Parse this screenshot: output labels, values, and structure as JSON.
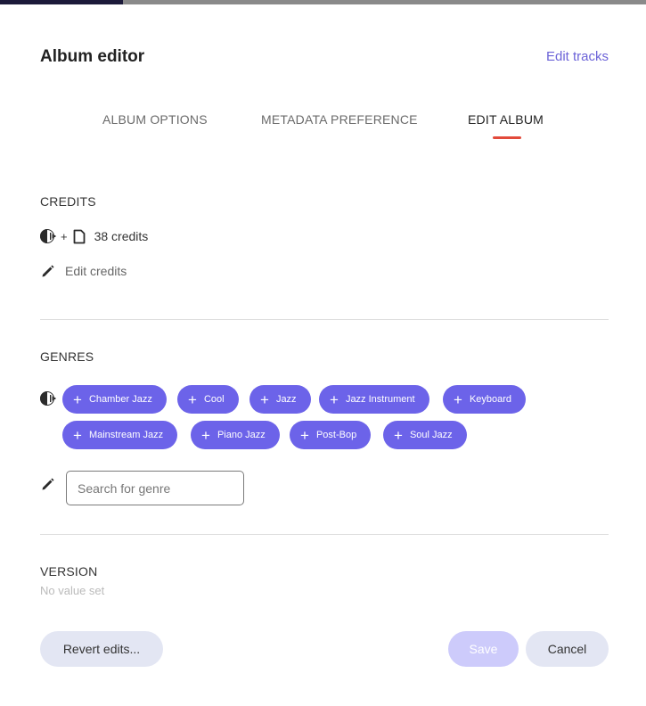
{
  "progress": {
    "fraction": 0.19
  },
  "header": {
    "title": "Album editor",
    "edit_tracks_label": "Edit tracks"
  },
  "tabs": [
    {
      "label": "ALBUM OPTIONS",
      "active": false
    },
    {
      "label": "METADATA PREFERENCE",
      "active": false
    },
    {
      "label": "EDIT ALBUM",
      "active": true
    }
  ],
  "credits": {
    "title": "CREDITS",
    "plus": "+",
    "count_label": "38 credits",
    "edit_label": "Edit credits",
    "icons": [
      "audio-source-icon",
      "document-icon",
      "pencil-icon"
    ]
  },
  "genres": {
    "title": "GENRES",
    "items": [
      "Chamber Jazz",
      "Cool",
      "Jazz",
      "Jazz Instrument",
      "Keyboard",
      "Mainstream Jazz",
      "Piano Jazz",
      "Post-Bop",
      "Soul Jazz"
    ],
    "search_placeholder": "Search for genre",
    "chip_icon": "plus-icon"
  },
  "version": {
    "title": "VERSION",
    "value": "No value set"
  },
  "actions": {
    "revert_label": "Revert edits...",
    "save_label": "Save",
    "cancel_label": "Cancel"
  },
  "colors": {
    "accent": "#6c63e9",
    "link": "#6c63d8",
    "tab_underline": "#e24a3b",
    "save_disabled": "#cdcbfb",
    "secondary_button": "#e3e6f3"
  }
}
